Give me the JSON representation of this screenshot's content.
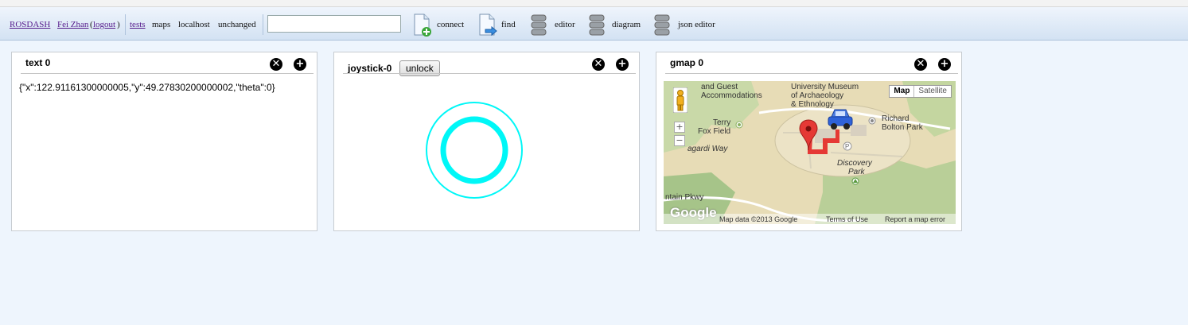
{
  "toolbar": {
    "rosdash": "ROSDASH",
    "user": "Fei Zhan",
    "logout": "logout",
    "tests": "tests",
    "maps": "maps",
    "localhost": "localhost",
    "unchanged": "unchanged",
    "search_value": "",
    "connect": "connect",
    "find": "find",
    "editor": "editor",
    "diagram": "diagram",
    "json_editor": "json editor"
  },
  "panels": {
    "text": {
      "title": "text 0",
      "content": "{\"x\":122.91161300000005,\"y\":49.27830200000002,\"theta\":0}"
    },
    "joystick": {
      "title": "joystick-0",
      "unlock": "unlock",
      "ring_color": "#00f7f7"
    },
    "gmap": {
      "title": "gmap 0",
      "map_button": "Map",
      "satellite_button": "Satellite",
      "labels": {
        "guest1": "and Guest",
        "guest2": "Accommodations",
        "museum1": "University Museum",
        "museum2": "of Archaeology",
        "museum3": "& Ethnology",
        "terry1": "Terry",
        "terry2": "Fox Field",
        "richard1": "Richard",
        "richard2": "Bolton Park",
        "way": "agardi Way",
        "discovery1": "Discovery",
        "discovery2": "Park",
        "pkwy": "ntain Pkwy",
        "google": "Google"
      },
      "footer": {
        "map_data": "Map data ©2013 Google",
        "terms": "Terms of Use",
        "report": "Report a map error"
      }
    }
  },
  "colors": {
    "accent": "#00f7f7",
    "marker": "#e53935"
  }
}
